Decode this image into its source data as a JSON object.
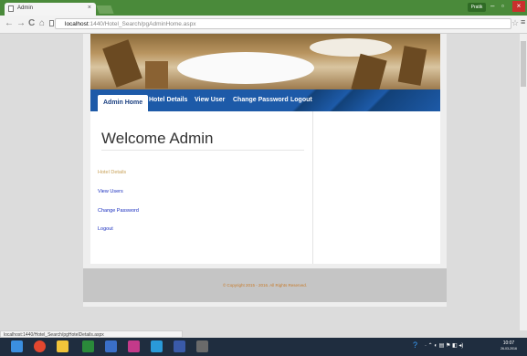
{
  "browser": {
    "tab_title": "Admin",
    "tab_close": "×",
    "user_button": "Pratik",
    "window_min": "–",
    "window_max": "▫",
    "window_close": "×",
    "back": "←",
    "forward": "→",
    "reload": "C",
    "home": "⌂",
    "url_host": "localhost",
    "url_path": ":1440/Hotel_Search/pgAdminHome.aspx",
    "star": "☆",
    "menu": "≡",
    "status_url": "localhost:1440/Hotel_Search/pgHotelDetails.aspx"
  },
  "site": {
    "nav": [
      {
        "label": "Admin Home",
        "active": true
      },
      {
        "label": "Hotel Details"
      },
      {
        "label": "View User"
      },
      {
        "label": "Change Password"
      },
      {
        "label": "Logout"
      }
    ],
    "welcome": "Welcome Admin",
    "links": [
      {
        "label": "Hotel Details",
        "visited": true
      },
      {
        "label": "View Users"
      },
      {
        "label": "Change Password"
      },
      {
        "label": "Logout"
      }
    ],
    "footer": "© Copyright 2015 - 2016. All Rights Reserved."
  },
  "taskbar": {
    "tray_help": "?",
    "clock_time": "10:07",
    "clock_date": "26-03-2016"
  },
  "colors": {
    "nav_blue": "#1d5aa8",
    "link_blue": "#1a2fbf",
    "visited_link": "#c8a25a",
    "chrome_green": "#4a8a3a"
  }
}
